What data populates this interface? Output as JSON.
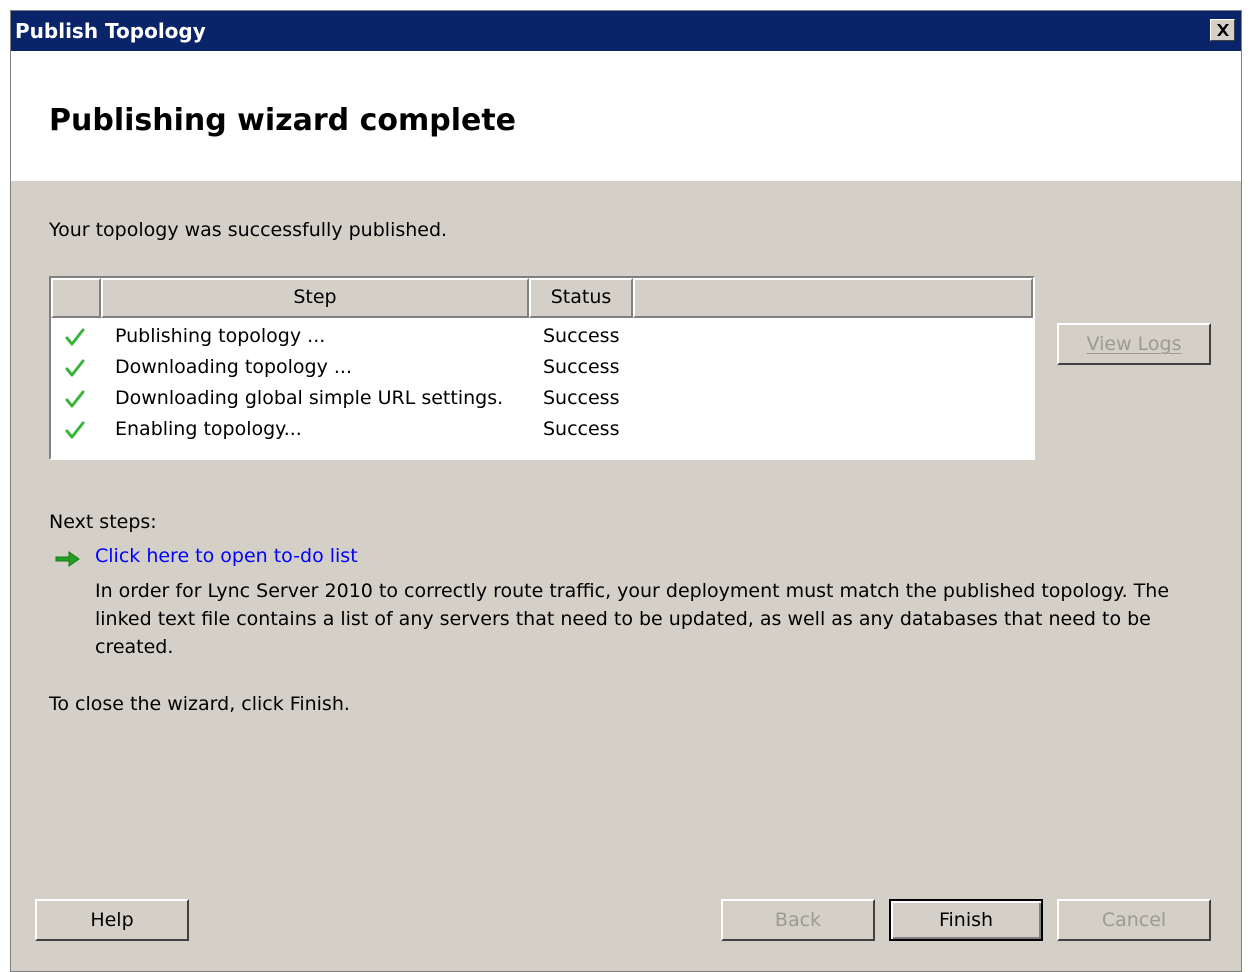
{
  "window": {
    "title": "Publish Topology",
    "close_icon": "close-x-icon"
  },
  "header": {
    "title": "Publishing wizard complete"
  },
  "intro_text": "Your topology was successfully published.",
  "table": {
    "columns": [
      "",
      "Step",
      "Status",
      ""
    ],
    "rows": [
      {
        "icon": "check-icon",
        "step": "Publishing topology ...",
        "status": "Success"
      },
      {
        "icon": "check-icon",
        "step": "Downloading topology ...",
        "status": "Success"
      },
      {
        "icon": "check-icon",
        "step": "Downloading global simple URL settings.",
        "status": "Success"
      },
      {
        "icon": "check-icon",
        "step": "Enabling topology...",
        "status": "Success"
      }
    ]
  },
  "view_logs_label": "View Logs",
  "next_steps": {
    "heading": "Next steps:",
    "link_icon": "green-arrow-icon",
    "link_text": "Click here to open to-do list",
    "description": "In order for Lync Server 2010 to correctly route traffic, your deployment must match the published topology. The linked text file contains a list of any servers that need to be updated, as well as any databases that need to be created."
  },
  "close_instruction": "To close the wizard, click Finish.",
  "buttons": {
    "help": "Help",
    "back": "Back",
    "finish": "Finish",
    "cancel": "Cancel"
  },
  "colors": {
    "titlebar": "#0a246a",
    "dialog_bg": "#d4d0c8",
    "link": "#0000ff",
    "check": "#3cb43c"
  }
}
